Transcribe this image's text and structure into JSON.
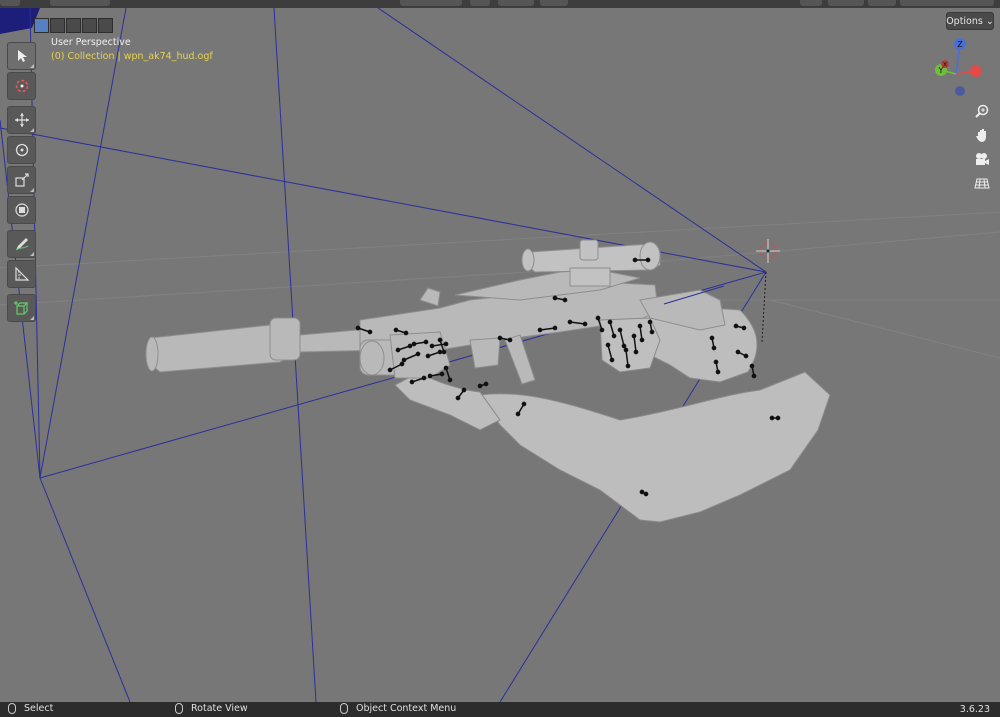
{
  "viewport": {
    "perspective_label": "User Perspective",
    "collection_label": "(0) Collection | wpn_ak74_hud.ogf",
    "options_label": "Options"
  },
  "gizmo": {
    "axes": [
      {
        "name": "X",
        "color": "#e34b4b"
      },
      {
        "name": "Y",
        "color": "#6fbf3a"
      },
      {
        "name": "Z",
        "color": "#4a6fd6"
      }
    ]
  },
  "nav_icons": [
    "zoom-icon",
    "hand-pan-icon",
    "camera-icon",
    "grid-ortho-icon"
  ],
  "tools": [
    "select-box-tool",
    "cursor-tool",
    "move-tool",
    "rotate-tool",
    "scale-tool",
    "transform-tool",
    "annotate-tool",
    "measure-tool",
    "add-cube-tool"
  ],
  "statusbar": {
    "left_action": "Select",
    "middle_action": "Rotate View",
    "right_action": "Object Context Menu",
    "version": "3.6.23"
  },
  "colors": {
    "viewport_bg": "#777777",
    "frustum_line": "#2c2f9a",
    "active_collection": "#e8d34a",
    "mesh": "#b9b9b9"
  }
}
